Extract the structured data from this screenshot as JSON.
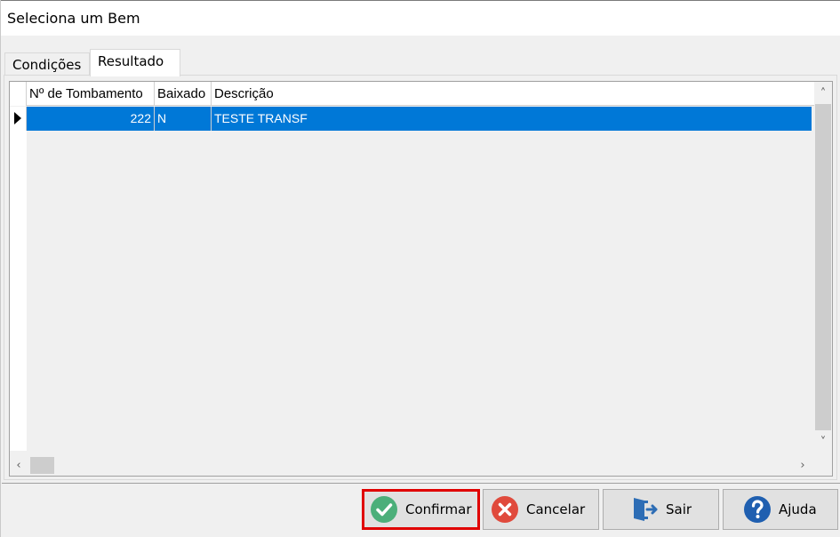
{
  "window": {
    "title": "Seleciona um Bem"
  },
  "tabs": [
    {
      "label": "Condições",
      "active": false
    },
    {
      "label": "Resultado",
      "active": true
    }
  ],
  "grid": {
    "columns": [
      "Nº de Tombamento",
      "Baixado",
      "Descrição"
    ],
    "rows": [
      {
        "tombamento": "222",
        "baixado": "N",
        "descricao": "TESTE TRANSF",
        "selected": true
      }
    ]
  },
  "buttons": {
    "confirmar": {
      "label": "Confirmar",
      "icon": "check-circle-icon",
      "color": "#4caf7a"
    },
    "cancelar": {
      "label": "Cancelar",
      "icon": "cancel-circle-icon",
      "color": "#e04a3c"
    },
    "sair": {
      "label": "Sair",
      "icon": "exit-door-icon",
      "color": "#2d6db5"
    },
    "ajuda": {
      "label": "Ajuda",
      "icon": "help-circle-icon",
      "color": "#1f5fb0"
    }
  },
  "colors": {
    "selection": "#0078d7",
    "highlight_border": "#e00000"
  }
}
